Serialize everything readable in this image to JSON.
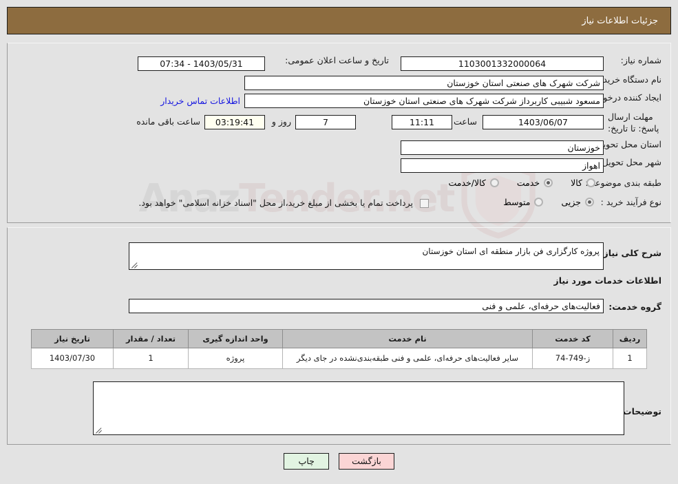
{
  "header": {
    "title": "جزئیات اطلاعات نیاز"
  },
  "form": {
    "need_number_label": "شماره نیاز:",
    "need_number_value": "1103001332000064",
    "announce_datetime_label": "تاریخ و ساعت اعلان عمومی:",
    "announce_datetime_value": "1403/05/31 - 07:34",
    "buyer_org_label": "نام دستگاه خریدار:",
    "buyer_org_value": "شرکت شهرک های صنعتی استان خوزستان",
    "creator_label": "ایجاد کننده درخواست:",
    "creator_value": "مسعود شبیبی کاربرداز شرکت شهرک های صنعتی استان خوزستان",
    "contact_link": "اطلاعات تماس خریدار",
    "deadline_label": "مهلت ارسال پاسخ: تا تاریخ:",
    "deadline_date": "1403/06/07",
    "deadline_hour_label": "ساعت",
    "deadline_hour": "11:11",
    "remaining_days": "7",
    "remaining_days_label": "روز و",
    "remaining_time": "03:19:41",
    "remaining_time_label": "ساعت باقی مانده",
    "province_label": "استان محل تحویل:",
    "province_value": "خوزستان",
    "city_label": "شهر محل تحویل:",
    "city_value": "اهواز",
    "category_label": "طبقه بندی موضوعی:",
    "category_options": [
      {
        "label": "کالا",
        "selected": false
      },
      {
        "label": "خدمت",
        "selected": true
      },
      {
        "label": "کالا/خدمت",
        "selected": false
      }
    ],
    "process_label": "نوع فرآیند خرید :",
    "process_options": [
      {
        "label": "جزیی",
        "selected": true
      },
      {
        "label": "متوسط",
        "selected": false
      }
    ],
    "treasury_checkbox_checked": false,
    "treasury_text": "پرداخت تمام یا بخشی از مبلغ خرید،از محل \"اسناد خزانه اسلامی\" خواهد بود."
  },
  "details": {
    "general_desc_label": "شرح کلی نیاز:",
    "general_desc_value": "پروژه کارگزاری فن بازار منطقه ای استان خوزستان",
    "services_info_heading": "اطلاعات خدمات مورد نیاز",
    "service_group_label": "گروه خدمت:",
    "service_group_value": "فعالیت‌های حرفه‌ای، علمی و فنی",
    "buyer_notes_label": "توضیحات خریدار:",
    "buyer_notes_value": ""
  },
  "table": {
    "headers": [
      "ردیف",
      "کد خدمت",
      "نام خدمت",
      "واحد اندازه گیری",
      "تعداد / مقدار",
      "تاریخ نیاز"
    ],
    "rows": [
      {
        "row_no": "1",
        "service_code": "ز-749-74",
        "service_name": "سایر فعالیت‌های حرفه‌ای، علمی و فنی طبقه‌بندی‌نشده در جای دیگر",
        "unit": "پروژه",
        "quantity": "1",
        "need_date": "1403/07/30"
      }
    ]
  },
  "footer": {
    "print_label": "چاپ",
    "back_label": "بازگشت"
  },
  "watermark": {
    "text_left": "Anaz",
    "text_right": "Tender.net"
  },
  "colors": {
    "header_brown": "#8d6c3f",
    "page_bg": "#e3e3e3",
    "link_blue": "#1414e0",
    "table_header": "#c3c3c3",
    "btn_back": "#fbd5d5",
    "btn_print": "#e2f4e2",
    "timer_bg": "#fffff0"
  }
}
